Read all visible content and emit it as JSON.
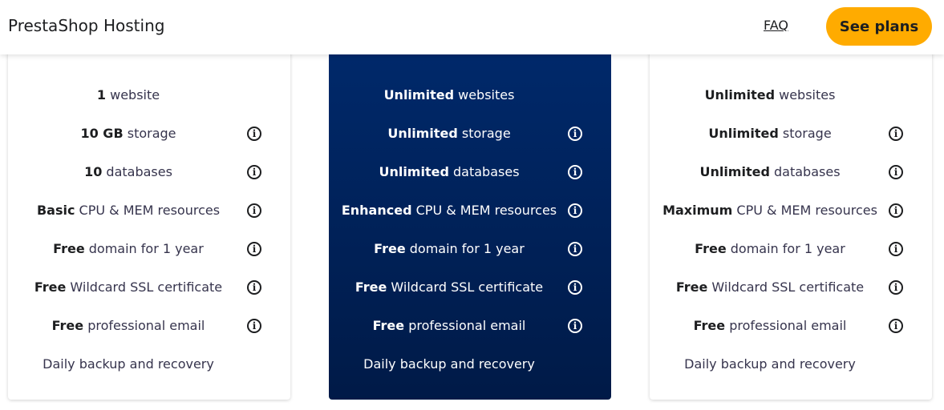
{
  "header": {
    "brand": "PrestaShop Hosting",
    "faq_label": "FAQ",
    "cta_label": "See plans"
  },
  "plans": [
    {
      "features": [
        {
          "bold": "1",
          "text": " website",
          "info": false
        },
        {
          "bold": "10 GB",
          "text": " storage",
          "info": true
        },
        {
          "bold": "10",
          "text": " databases",
          "info": true
        },
        {
          "bold": "Basic",
          "text": " CPU & MEM resources",
          "info": true
        },
        {
          "bold": "Free",
          "text": " domain for 1 year",
          "info": true
        },
        {
          "bold": "Free",
          "text": " Wildcard SSL certificate",
          "info": true
        },
        {
          "bold": "Free",
          "text": " professional email",
          "info": true
        },
        {
          "bold": "",
          "text": "Daily backup and recovery",
          "info": false
        }
      ]
    },
    {
      "features": [
        {
          "bold": "Unlimited",
          "text": " websites",
          "info": false
        },
        {
          "bold": "Unlimited",
          "text": " storage",
          "info": true
        },
        {
          "bold": "Unlimited",
          "text": " databases",
          "info": true
        },
        {
          "bold": "Enhanced",
          "text": " CPU & MEM resources",
          "info": true
        },
        {
          "bold": "Free",
          "text": " domain for 1 year",
          "info": true
        },
        {
          "bold": "Free",
          "text": " Wildcard SSL certificate",
          "info": true
        },
        {
          "bold": "Free",
          "text": " professional email",
          "info": true
        },
        {
          "bold": "",
          "text": "Daily backup and recovery",
          "info": false
        }
      ]
    },
    {
      "features": [
        {
          "bold": "Unlimited",
          "text": " websites",
          "info": false
        },
        {
          "bold": "Unlimited",
          "text": " storage",
          "info": true
        },
        {
          "bold": "Unlimited",
          "text": " databases",
          "info": true
        },
        {
          "bold": "Maximum",
          "text": " CPU & MEM resources",
          "info": true
        },
        {
          "bold": "Free",
          "text": " domain for 1 year",
          "info": true
        },
        {
          "bold": "Free",
          "text": " Wildcard SSL certificate",
          "info": true
        },
        {
          "bold": "Free",
          "text": " professional email",
          "info": true
        },
        {
          "bold": "",
          "text": "Daily backup and recovery",
          "info": false
        }
      ]
    }
  ],
  "icons": {
    "info": "info-circle-icon",
    "info_glyph": "i"
  }
}
